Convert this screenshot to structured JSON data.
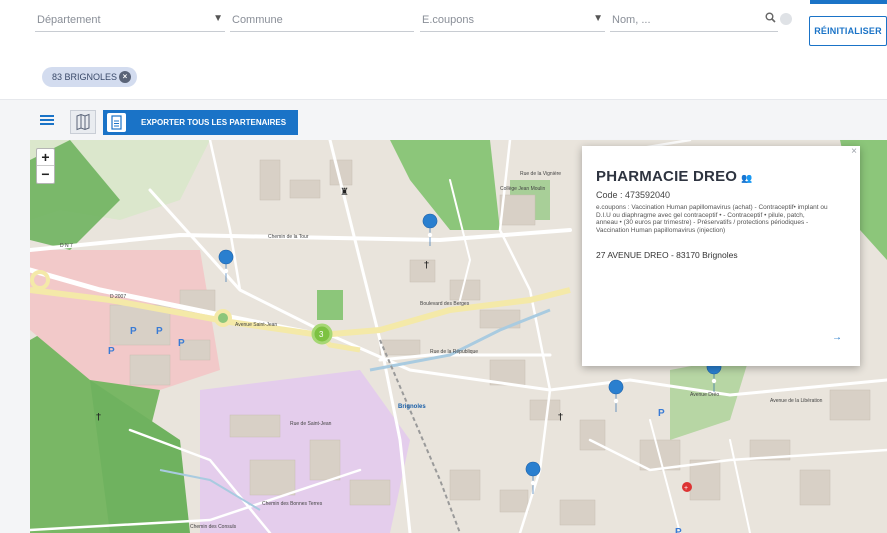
{
  "filters": {
    "departement_placeholder": "Département",
    "commune_placeholder": "Commune",
    "ecoupons_placeholder": "E.coupons",
    "nom_placeholder": "Nom, ...",
    "reset_label": "RÉINITIALISER",
    "chip_label": "83 BRIGNOLES"
  },
  "toolbar": {
    "export_label": "EXPORTER TOUS LES PARTENAIRES"
  },
  "map": {
    "zoom_in": "+",
    "zoom_out": "−",
    "cluster_count": "3",
    "labels": {
      "dn7": "D N 7",
      "d2007": "D 2007",
      "boulevard_berges": "Boulevard des Berges",
      "avenue_saint_jean": "Avenue Saint-Jean",
      "rue_republique": "Rue de la République",
      "avenue_dreo": "Avenue Dréo",
      "avenue_liberation": "Avenue de la Libération",
      "brignoles": "Brignoles",
      "chemin_tour": "Chemin de la Tour",
      "rue_saint_jean": "Rue de Saint-Jean",
      "chemin_bonnes_terres": "Chemin des Bonnes Terres",
      "college": "Collège Jean Moulin",
      "rue_vigniere": "Rue de la Vignière",
      "chemin_consuls": "Chemin des Consuls"
    }
  },
  "popup": {
    "close": "×",
    "title": "PHARMACIE DREO",
    "title_icon": "people-icon",
    "code": "Code : 473592040",
    "description": "e.coupons : Vaccination Human papillomavirus (achat) - Contraceptif• implant ou D.I.U ou diaphragme avec gel contraceptif • - Contraceptif • pilule, patch, anneau • (30 euros par trimestre) - Préservatifs / protections périodiques - Vaccination Human papillomavirus (injection)",
    "address": "27 AVENUE DREO - 83170 Brignoles",
    "arrow": "→"
  },
  "colors": {
    "accent": "#1a73c7",
    "map_base": "#e9e4dc",
    "green": "#8cc67a",
    "forest": "#6fb25f",
    "road": "#ffffff",
    "highway": "#f4e9a8",
    "commercial": "#f2c9c9",
    "industrial": "#e4cdec",
    "cluster": "#7dc242"
  }
}
